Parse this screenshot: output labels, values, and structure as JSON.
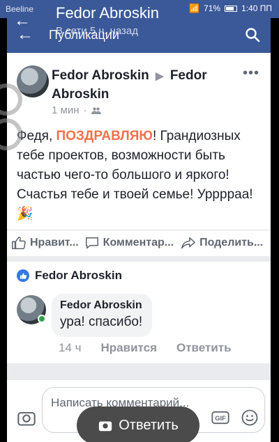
{
  "statusbar": {
    "carrier": "Beeline",
    "battery": "71%",
    "time": "1:40 ПП"
  },
  "overlay": {
    "name": "Fedor Abroskin",
    "status": "В сети 5 ч. назад"
  },
  "appbar": {
    "title": "Публикации"
  },
  "post": {
    "author": "Fedor Abroskin",
    "target": "Fedor Abroskin",
    "time": "1 мин",
    "text_before": "Федя, ",
    "text_highlight": "ПОЗДРАВЛЯЮ",
    "text_after": "! Грандиозных тебе проектов, возможности быть частью чего-то большого и яркого! Счастья тебе и твоей семье! Урррраа! ",
    "emoji": "🎉",
    "actions": {
      "like": "Нравит...",
      "comment": "Комментар...",
      "share": "Поделить..."
    }
  },
  "likes": {
    "name": "Fedor Abroskin"
  },
  "comment": {
    "author": "Fedor Abroskin",
    "text": "ура! спасибо!",
    "time": "14 ч",
    "like": "Нравится",
    "reply": "Ответить"
  },
  "composer": {
    "placeholder": "Написать комментарий..."
  },
  "reply_pill": {
    "label": "Ответить"
  },
  "colors": {
    "brand": "#3b5998",
    "highlight": "#f3704c",
    "like_blue": "#3578e5"
  }
}
